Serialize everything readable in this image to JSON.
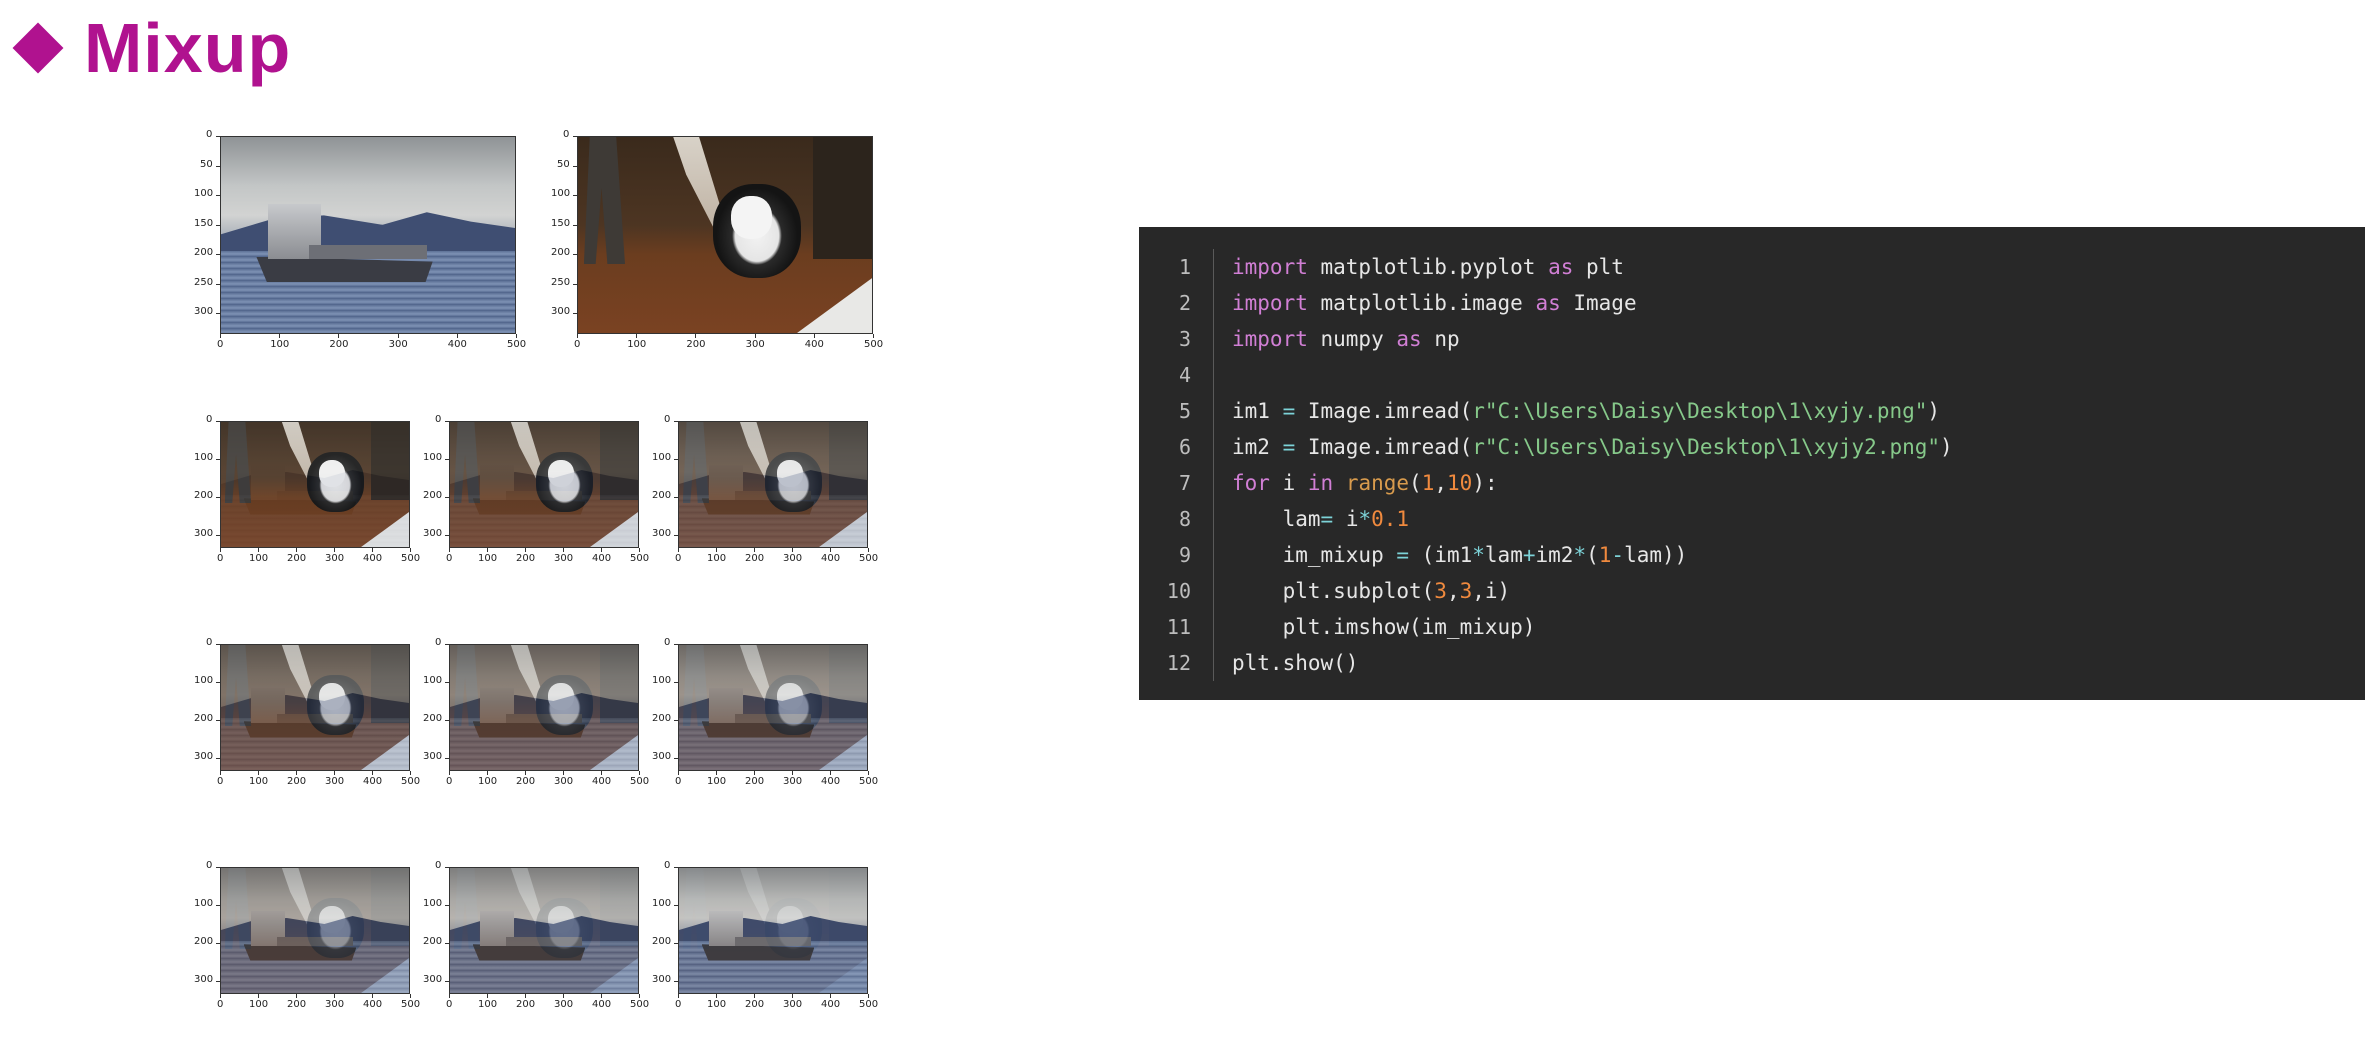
{
  "title": {
    "text": "Mixup",
    "color": "#b0128f",
    "bullet_icon": "diamond-icon"
  },
  "figure": {
    "top_row": [
      {
        "name": "ship",
        "x_ticks": [
          "0",
          "100",
          "200",
          "300",
          "400",
          "500"
        ],
        "y_ticks": [
          "0",
          "50",
          "100",
          "150",
          "200",
          "250",
          "300"
        ]
      },
      {
        "name": "dog",
        "x_ticks": [
          "0",
          "100",
          "200",
          "300",
          "400",
          "500"
        ],
        "y_ticks": [
          "0",
          "50",
          "100",
          "150",
          "200",
          "250",
          "300"
        ]
      }
    ],
    "mixed_grid": {
      "x_ticks": [
        "0",
        "100",
        "200",
        "300",
        "400",
        "500"
      ],
      "y_ticks": [
        "0",
        "100",
        "200",
        "300"
      ],
      "ship_weights": [
        0.1,
        0.2,
        0.3,
        0.4,
        0.5,
        0.6,
        0.7,
        0.8,
        0.9
      ]
    }
  },
  "code": {
    "background": "#282828",
    "lines": [
      {
        "no": "1",
        "tokens": [
          [
            "kw",
            "import"
          ],
          [
            "fn",
            " matplotlib.pyplot "
          ],
          [
            "kw",
            "as"
          ],
          [
            "fn",
            " plt"
          ]
        ]
      },
      {
        "no": "2",
        "tokens": [
          [
            "kw",
            "import"
          ],
          [
            "fn",
            " matplotlib.image "
          ],
          [
            "kw",
            "as"
          ],
          [
            "fn",
            " Image"
          ]
        ]
      },
      {
        "no": "3",
        "tokens": [
          [
            "kw",
            "import"
          ],
          [
            "fn",
            " numpy "
          ],
          [
            "kw",
            "as"
          ],
          [
            "fn",
            " np"
          ]
        ]
      },
      {
        "no": "4",
        "tokens": []
      },
      {
        "no": "5",
        "tokens": [
          [
            "fn",
            "im1 "
          ],
          [
            "op",
            "="
          ],
          [
            "fn",
            " Image.imread("
          ],
          [
            "str",
            "r\"C:\\Users\\Daisy\\Desktop\\1\\xyjy.png\""
          ],
          [
            "fn",
            ")"
          ]
        ]
      },
      {
        "no": "6",
        "tokens": [
          [
            "fn",
            "im2 "
          ],
          [
            "op",
            "="
          ],
          [
            "fn",
            " Image.imread("
          ],
          [
            "str",
            "r\"C:\\Users\\Daisy\\Desktop\\1\\xyjy2.png\""
          ],
          [
            "fn",
            ")"
          ]
        ]
      },
      {
        "no": "7",
        "tokens": [
          [
            "kw",
            "for"
          ],
          [
            "fn",
            " i "
          ],
          [
            "kw",
            "in"
          ],
          [
            "fn",
            " "
          ],
          [
            "kw2",
            "range"
          ],
          [
            "fn",
            "("
          ],
          [
            "num",
            "1"
          ],
          [
            "fn",
            ","
          ],
          [
            "num",
            "10"
          ],
          [
            "fn",
            "):"
          ]
        ]
      },
      {
        "no": "8",
        "tokens": [
          [
            "fn",
            "    lam"
          ],
          [
            "op",
            "="
          ],
          [
            "fn",
            " i"
          ],
          [
            "op",
            "*"
          ],
          [
            "num",
            "0.1"
          ]
        ]
      },
      {
        "no": "9",
        "tokens": [
          [
            "fn",
            "    im_mixup "
          ],
          [
            "op",
            "="
          ],
          [
            "fn",
            " (im1"
          ],
          [
            "op",
            "*"
          ],
          [
            "fn",
            "lam"
          ],
          [
            "op",
            "+"
          ],
          [
            "fn",
            "im2"
          ],
          [
            "op",
            "*"
          ],
          [
            "fn",
            "("
          ],
          [
            "num",
            "1"
          ],
          [
            "op",
            "-"
          ],
          [
            "fn",
            "lam))"
          ]
        ]
      },
      {
        "no": "10",
        "tokens": [
          [
            "fn",
            "    plt.subplot("
          ],
          [
            "num",
            "3"
          ],
          [
            "fn",
            ","
          ],
          [
            "num",
            "3"
          ],
          [
            "fn",
            ",i)"
          ]
        ]
      },
      {
        "no": "11",
        "tokens": [
          [
            "fn",
            "    plt.imshow(im_mixup)"
          ]
        ]
      },
      {
        "no": "12",
        "tokens": [
          [
            "fn",
            "plt.show()"
          ]
        ]
      }
    ]
  }
}
